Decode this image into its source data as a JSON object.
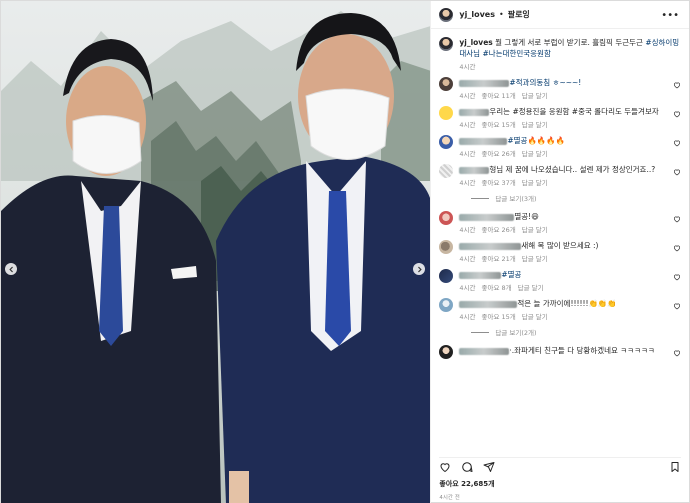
{
  "post": {
    "username": "yj_loves",
    "follow_label": "팔로잉",
    "caption_prefix": " 뭘 그렇게 서로 부럽이 받기로. 흘림픽 두근두근 ",
    "caption_tags": "#싱하이밍 대사님 #나는대한민국응원함",
    "caption_time": "4시간",
    "likes_label": "좋아요 22,685개",
    "post_time": "4시간 전"
  },
  "comments": [
    {
      "avatar": "av-a",
      "blur_w": 50,
      "text": "#적과의동침 ㅎ~~~!",
      "tag_prefix": true,
      "time": "4시간",
      "likes": "좋아요 11개",
      "reply": "답글 달기",
      "view_replies": ""
    },
    {
      "avatar": "av-b",
      "blur_w": 30,
      "text": "우리는 #정용진을 응원함 #중국 롤다리도 두들겨보자",
      "tag_prefix": false,
      "time": "4시간",
      "likes": "좋아요 15개",
      "reply": "답글 달기",
      "view_replies": ""
    },
    {
      "avatar": "av-c",
      "blur_w": 48,
      "text": "#멸공🔥🔥🔥🔥",
      "tag_prefix": true,
      "time": "4시간",
      "likes": "좋아요 26개",
      "reply": "답글 달기",
      "view_replies": ""
    },
    {
      "avatar": "av-d",
      "blur_w": 30,
      "text": "형님 제 꿈에 나오셨습니다.. 설렌 제가 정상인거죠..?",
      "tag_prefix": false,
      "time": "4시간",
      "likes": "좋아요 37개",
      "reply": "답글 달기",
      "view_replies": "답글 보기(3개)"
    },
    {
      "avatar": "av-e",
      "blur_w": 55,
      "text": "멸공!😄",
      "tag_prefix": false,
      "time": "4시간",
      "likes": "좋아요 26개",
      "reply": "답글 달기",
      "view_replies": ""
    },
    {
      "avatar": "av-f",
      "blur_w": 62,
      "text": "새해 복 많이 받으세요 :)",
      "tag_prefix": false,
      "time": "4시간",
      "likes": "좋아요 21개",
      "reply": "답글 달기",
      "view_replies": ""
    },
    {
      "avatar": "av-g",
      "blur_w": 42,
      "text": "#멸공",
      "tag_prefix": true,
      "time": "4시간",
      "likes": "좋아요 8개",
      "reply": "답글 달기",
      "view_replies": ""
    },
    {
      "avatar": "av-h",
      "blur_w": 58,
      "text": "적은 늘 가까이에!!!!!!👏👏👏",
      "tag_prefix": false,
      "time": "4시간",
      "likes": "좋아요 15개",
      "reply": "답글 달기",
      "view_replies": "답글 보기(2개)"
    },
    {
      "avatar": "av-i",
      "blur_w": 50,
      "text": "·.좌파게티 친구들 다 당황하겠네요 ㅋㅋㅋㅋㅋ",
      "tag_prefix": false,
      "time": "",
      "likes": "",
      "reply": "",
      "view_replies": ""
    }
  ],
  "icons": [
    "heart-icon",
    "comment-icon",
    "share-icon",
    "bookmark-icon",
    "more-icon",
    "chevron-left-icon",
    "chevron-right-icon"
  ],
  "colors": {
    "tag": "#00376b",
    "meta": "#8e8e8e",
    "text": "#262626"
  }
}
